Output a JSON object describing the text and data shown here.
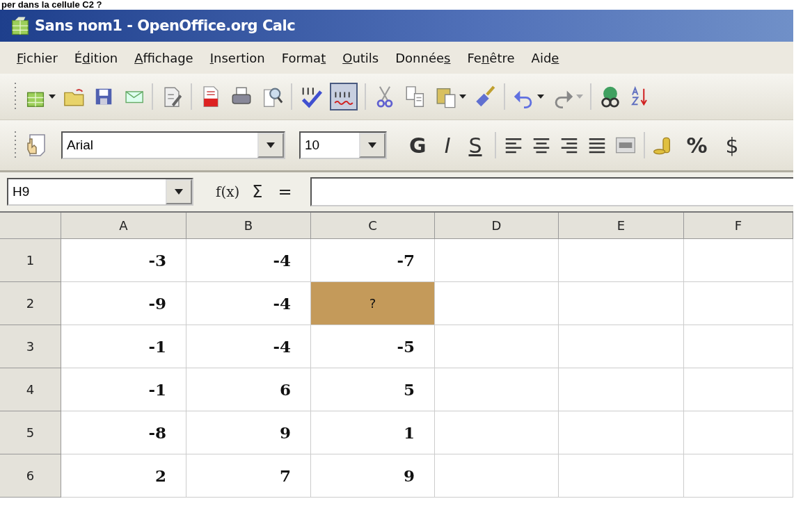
{
  "caption": "per dans la cellule C2 ?",
  "window": {
    "title": "Sans nom1 - OpenOffice.org Calc"
  },
  "menu": [
    {
      "key": "F",
      "after": "ichier"
    },
    {
      "before": "É",
      "key": "d",
      "after": "ition"
    },
    {
      "key": "A",
      "after": "ffichage"
    },
    {
      "key": "I",
      "after": "nsertion"
    },
    {
      "before": "Forma",
      "key": "t"
    },
    {
      "key": "O",
      "after": "utils"
    },
    {
      "before": "Donnée",
      "key": "s"
    },
    {
      "before": "Fe",
      "key": "n",
      "after": "être"
    },
    {
      "before": "Aid",
      "key": "e"
    }
  ],
  "standard_toolbar": {
    "auto_spellcheck": {
      "on": true
    }
  },
  "format_toolbar": {
    "font": "Arial",
    "size": "10",
    "bold": "G",
    "italic": "I",
    "underline": "S",
    "percent": "%",
    "currency": "$"
  },
  "formula_bar": {
    "name_box": "H9",
    "function_label": "f(x)",
    "sum": "Σ",
    "equals": "="
  },
  "grid": {
    "columns": [
      "A",
      "B",
      "C",
      "D",
      "E",
      "F"
    ],
    "rows": [
      {
        "header": "1",
        "cells": [
          {
            "value": "-3",
            "selected": false
          },
          {
            "value": "-4",
            "selected": false
          },
          {
            "value": "-7",
            "selected": false
          },
          {
            "selected": false
          },
          {
            "selected": false
          },
          {
            "selected": false
          }
        ]
      },
      {
        "header": "2",
        "cells": [
          {
            "value": "-9",
            "selected": false
          },
          {
            "value": "-4",
            "selected": false
          },
          {
            "value": "?",
            "selected": true
          },
          {
            "selected": false
          },
          {
            "selected": false
          },
          {
            "selected": false
          }
        ]
      },
      {
        "header": "3",
        "cells": [
          {
            "value": "-1",
            "selected": false
          },
          {
            "value": "-4",
            "selected": false
          },
          {
            "value": "-5",
            "selected": false
          },
          {
            "selected": false
          },
          {
            "selected": false
          },
          {
            "selected": false
          }
        ]
      },
      {
        "header": "4",
        "cells": [
          {
            "value": "-1",
            "selected": false
          },
          {
            "value": "6",
            "selected": false
          },
          {
            "value": "5",
            "selected": false
          },
          {
            "selected": false
          },
          {
            "selected": false
          },
          {
            "selected": false
          }
        ]
      },
      {
        "header": "5",
        "cells": [
          {
            "value": "-8",
            "selected": false
          },
          {
            "value": "9",
            "selected": false
          },
          {
            "value": "1",
            "selected": false
          },
          {
            "selected": false
          },
          {
            "selected": false
          },
          {
            "selected": false
          }
        ]
      },
      {
        "header": "6",
        "cells": [
          {
            "value": "2",
            "selected": false
          },
          {
            "value": "7",
            "selected": false
          },
          {
            "value": "9",
            "selected": false
          },
          {
            "selected": false
          },
          {
            "selected": false
          },
          {
            "selected": false
          }
        ]
      }
    ]
  }
}
